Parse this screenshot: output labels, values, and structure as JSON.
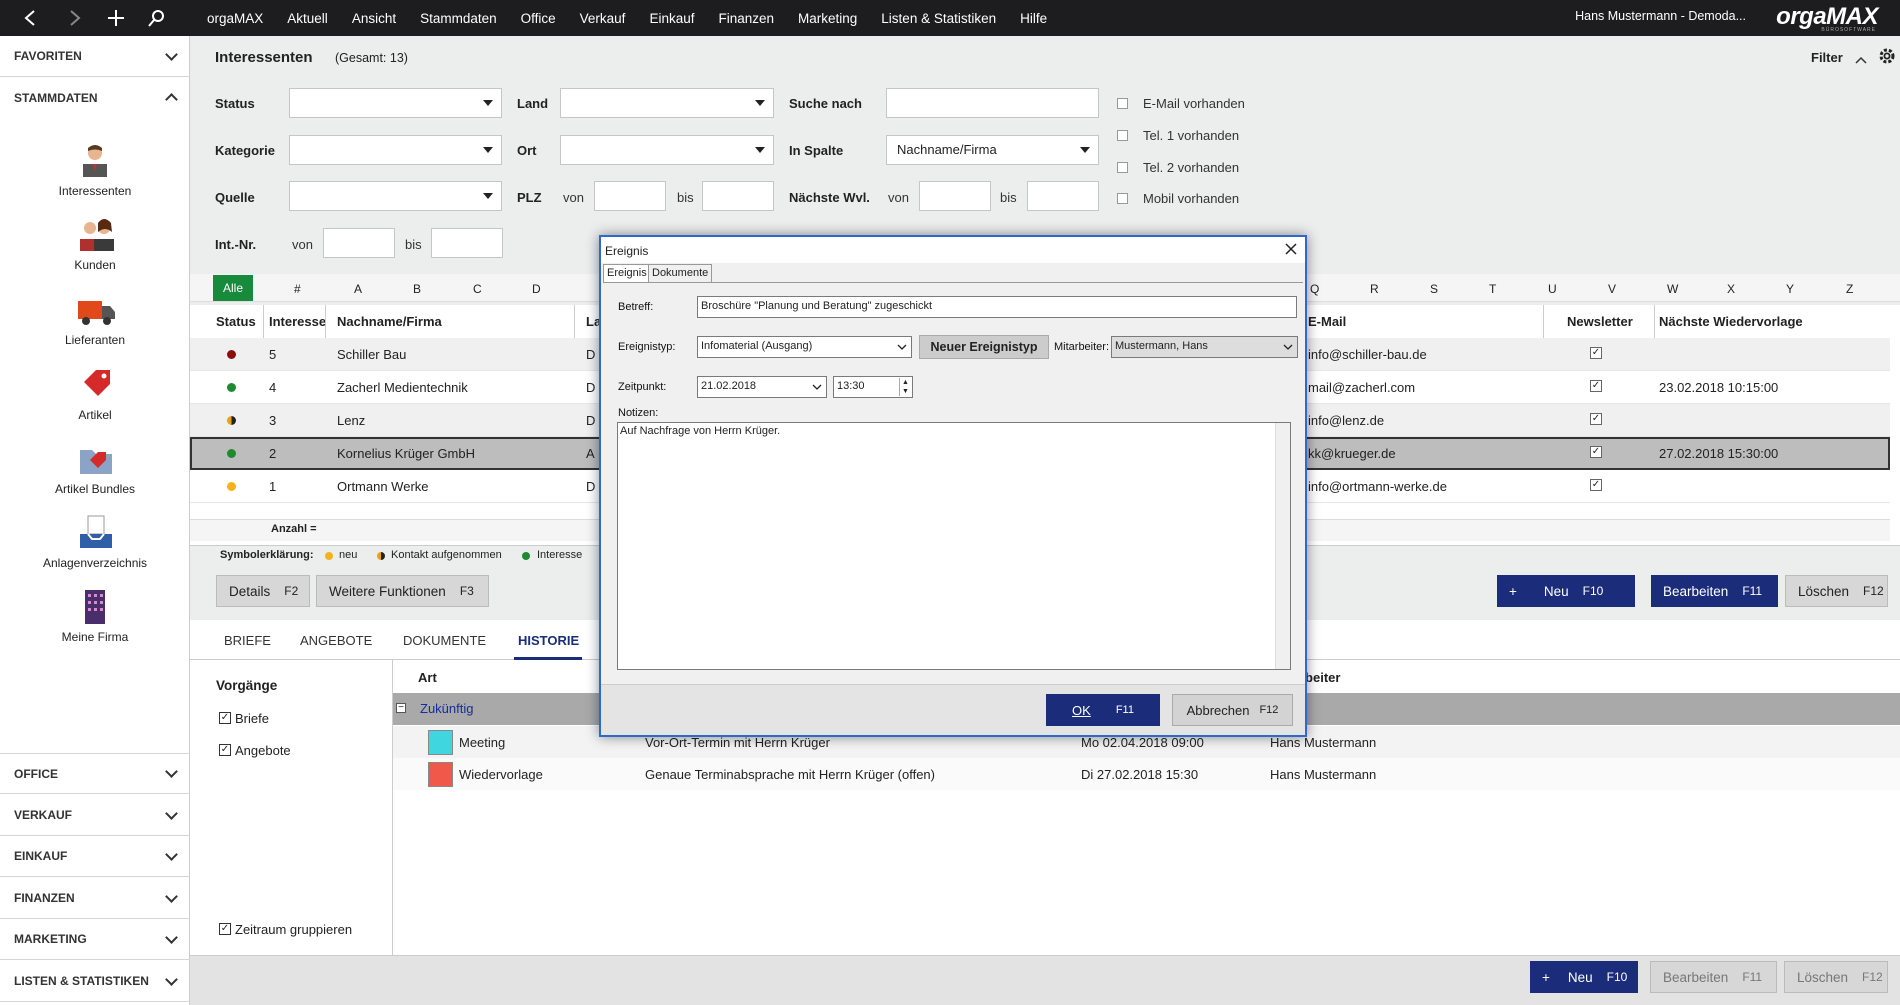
{
  "topbar": {
    "menu": [
      "orgaMAX",
      "Aktuell",
      "Ansicht",
      "Stammdaten",
      "Office",
      "Verkauf",
      "Einkauf",
      "Finanzen",
      "Marketing",
      "Listen & Statistiken",
      "Hilfe"
    ],
    "user": "Hans Mustermann - Demoda...",
    "logo": "orgaMAX",
    "logo_sub": "BÜROSOFTWARE"
  },
  "sidebar": {
    "favoriten": "FAVORITEN",
    "stammdaten": "STAMMDATEN",
    "items": [
      "Interessenten",
      "Kunden",
      "Lieferanten",
      "Artikel",
      "Artikel Bundles",
      "Anlagenverzeichnis",
      "Meine Firma"
    ],
    "bottom": [
      "OFFICE",
      "VERKAUF",
      "EINKAUF",
      "FINANZEN",
      "MARKETING",
      "LISTEN & STATISTIKEN"
    ]
  },
  "page": {
    "title": "Interessenten",
    "count": "(Gesamt: 13)",
    "filter": "Filter"
  },
  "filters": {
    "status": "Status",
    "kategorie": "Kategorie",
    "quelle": "Quelle",
    "intnr": "Int.-Nr.",
    "land": "Land",
    "ort": "Ort",
    "plz": "PLZ",
    "suche": "Suche nach",
    "inspalte": "In Spalte",
    "inspalte_value": "Nachname/Firma",
    "wvl": "Nächste Wvl.",
    "von": "von",
    "bis": "bis",
    "checks": [
      "E-Mail vorhanden",
      "Tel. 1 vorhanden",
      "Tel. 2 vorhanden",
      "Mobil vorhanden"
    ]
  },
  "letters": {
    "alle": "Alle",
    "list": [
      "#",
      "A",
      "B",
      "C",
      "D",
      "Q",
      "R",
      "S",
      "T",
      "U",
      "V",
      "W",
      "X",
      "Y",
      "Z"
    ]
  },
  "grid": {
    "headers": {
      "status": "Status",
      "interesse": "Interesse",
      "name": "Nachname/Firma",
      "land": "La",
      "email": "E-Mail",
      "newsletter": "Newsletter",
      "wvl": "Nächste Wiedervorlage"
    },
    "rows": [
      {
        "color": "#8b0f0f",
        "num": "5",
        "name": "Schiller Bau",
        "land": "D",
        "email": "info@schiller-bau.de",
        "wvl": ""
      },
      {
        "color": "#1f8a2f",
        "num": "4",
        "name": "Zacherl Medientechnik",
        "land": "D",
        "email": "mail@zacherl.com",
        "wvl": "23.02.2018 10:15:00"
      },
      {
        "color": "#e8a215",
        "num": "3",
        "name": "Lenz",
        "land": "D",
        "email": "info@lenz.de",
        "wvl": ""
      },
      {
        "color": "#1f8a2f",
        "num": "2",
        "name": "Kornelius Krüger GmbH",
        "land": "A",
        "email": "kk@krueger.de",
        "wvl": "27.02.2018 15:30:00"
      },
      {
        "color": "#f5b31a",
        "num": "1",
        "name": "Ortmann Werke",
        "land": "D",
        "email": "info@ortmann-werke.de",
        "wvl": ""
      }
    ],
    "anzahl": "Anzahl ="
  },
  "legend": {
    "label": "Symbolerklärung:",
    "items": [
      "neu",
      "Kontakt aufgenommen",
      "Interesse"
    ]
  },
  "buttons": {
    "details": "Details",
    "details_key": "F2",
    "weitere": "Weitere Funktionen",
    "weitere_key": "F3",
    "neu": "Neu",
    "neu_key": "F10",
    "bearbeiten": "Bearbeiten",
    "bearbeiten_key": "F11",
    "loeschen": "Löschen",
    "loeschen_key": "F12",
    "plus": "+"
  },
  "tabs": [
    "BRIEFE",
    "ANGEBOTE",
    "DOKUMENTE",
    "HISTORIE"
  ],
  "history": {
    "vorgaenge": "Vorgänge",
    "checks": [
      "Briefe",
      "Angebote"
    ],
    "zeitraum": "Zeitraum gruppieren",
    "col_art": "Art",
    "col_bearbeiter": "rbeiter",
    "group": "Zukünftig",
    "rows": [
      {
        "color": "#3fd6e0",
        "art": "Meeting",
        "text": "Vor-Ort-Termin mit Herrn Krüger",
        "date": "Mo 02.04.2018 09:00",
        "user": "Hans Mustermann"
      },
      {
        "color": "#f0584a",
        "art": "Wiedervorlage",
        "text": "Genaue Terminabsprache mit Herrn Krüger (offen)",
        "date": "Di 27.02.2018 15:30",
        "user": "Hans Mustermann"
      }
    ]
  },
  "dialog": {
    "title": "Ereignis",
    "tab1": "Ereignis",
    "tab2": "Dokumente",
    "betreff_label": "Betreff:",
    "betreff": "Broschüre \"Planung und Beratung\" zugeschickt",
    "typ_label": "Ereignistyp:",
    "typ": "Infomaterial (Ausgang)",
    "neuer_typ": "Neuer Ereignistyp",
    "mitarbeiter_label": "Mitarbeiter:",
    "mitarbeiter": "Mustermann, Hans",
    "zeit_label": "Zeitpunkt:",
    "datum": "21.02.2018",
    "uhrzeit": "13:30",
    "notizen_label": "Notizen:",
    "notizen": "Auf Nachfrage von Herrn Krüger.",
    "ok": "OK",
    "ok_key": "F11",
    "abbrechen": "Abbrechen",
    "abbrechen_key": "F12"
  }
}
